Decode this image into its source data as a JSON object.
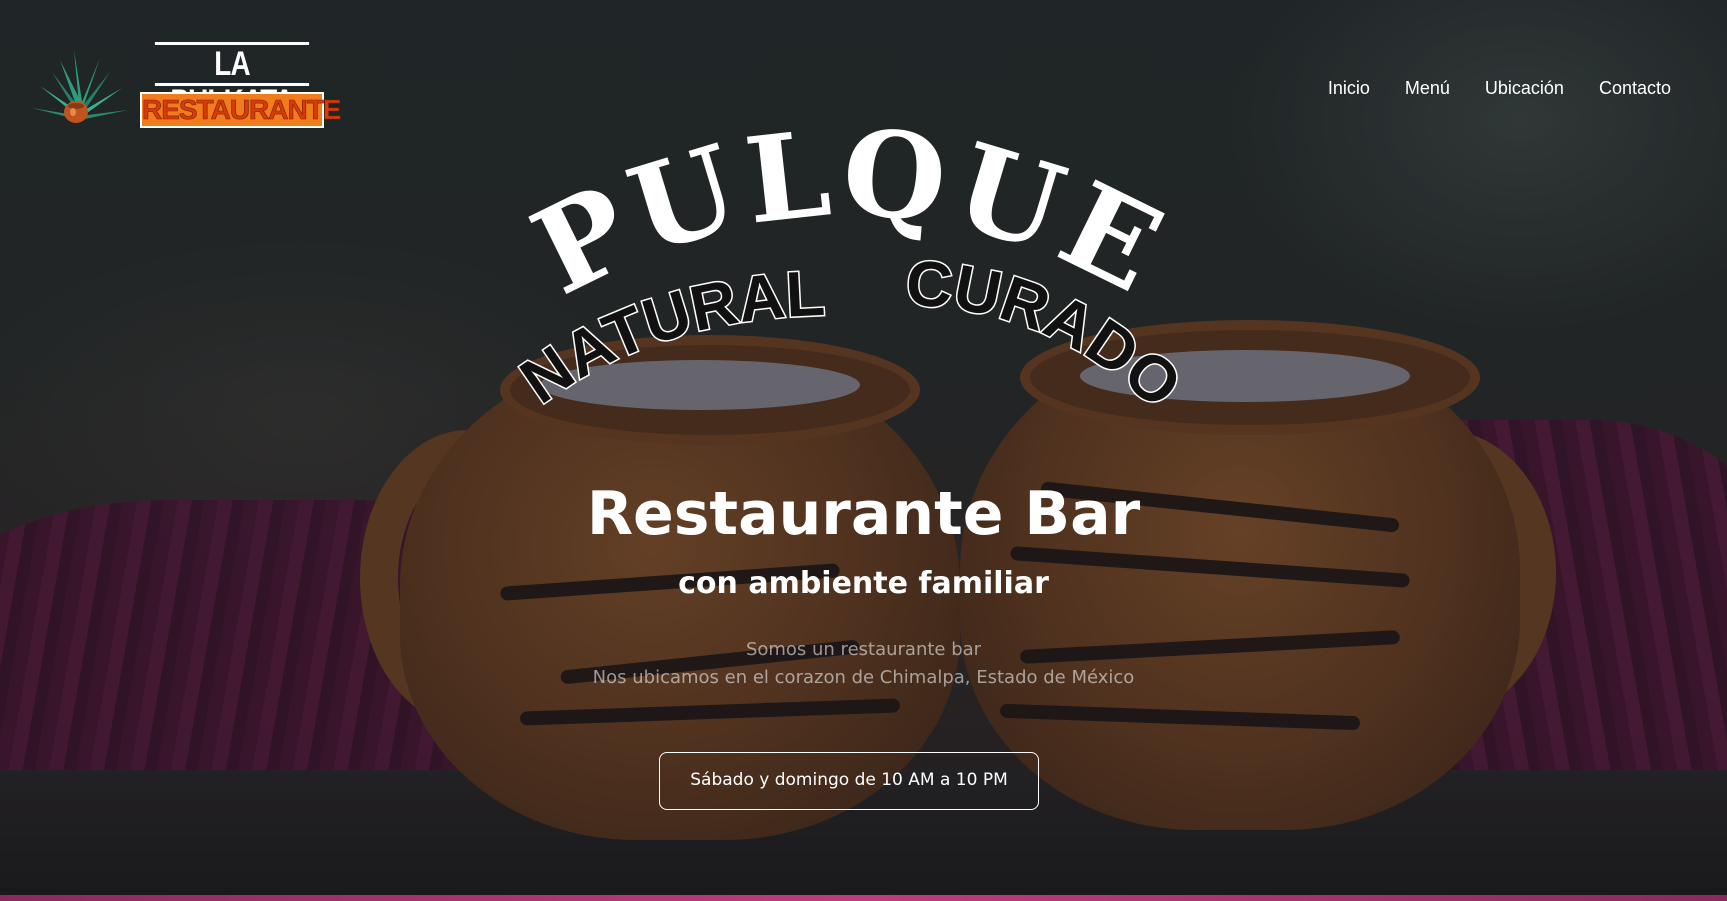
{
  "brand": {
    "name_top": "LA PULKATA",
    "name_bottom": "RESTAURANTE"
  },
  "nav": {
    "items": [
      {
        "label": "Inicio"
      },
      {
        "label": "Menú"
      },
      {
        "label": "Ubicación"
      },
      {
        "label": "Contacto"
      }
    ]
  },
  "graphic": {
    "headline": "PULQUE",
    "left_word": "NATURAL",
    "right_word": "CURADO"
  },
  "hero": {
    "title": "Restaurante Bar",
    "subtitle": "con ambiente familiar",
    "desc_line1": "Somos un restaurante bar",
    "desc_line2": "Nos ubicamos en el corazon de Chimalpa, Estado de México",
    "hours_button": "Sábado y domingo de 10 AM a 10 PM"
  },
  "colors": {
    "accent_orange": "#f07c1e",
    "accent_magenta": "#c13c7c",
    "text_white": "#ffffff"
  },
  "icons": {
    "logo": "agave-icon"
  }
}
